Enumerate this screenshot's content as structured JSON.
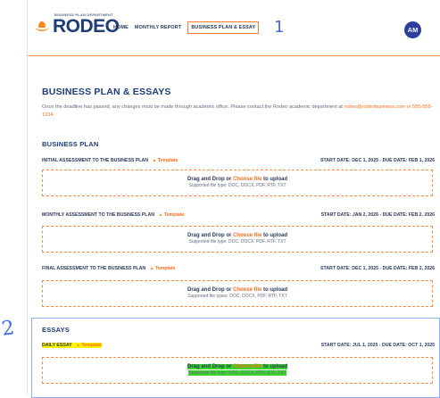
{
  "header": {
    "logo_tagline": "BUSINESS PLAN DEPARTMENT",
    "logo_word": "RODEO",
    "nav": [
      "HOME",
      "MONTHLY REPORT",
      "BUSINESS PLAN & ESSAY"
    ],
    "active_index": 2,
    "annotation_1": "1",
    "avatar_initials": "AM"
  },
  "main": {
    "title": "BUSINESS PLAN & ESSAYS",
    "notice_text": "Once the deadline has passed, any changes must be made through academic office. Please contact the Rodeo academic department at",
    "notice_contact": "rodeo@rodeobusiness.com or 555-555-1234."
  },
  "business_plan": {
    "section_title": "BUSINESS PLAN",
    "items": [
      {
        "label": "INITIAL ASSESSMENT TO THE BUSINESS PLAN",
        "template": "Template",
        "dates": "START DATE: DEC 1, 2025 - DUE DATE: FEB 1, 2026",
        "dz_prefix": "Drag and Drop or",
        "dz_choose": "Choose file",
        "dz_suffix": "to upload",
        "dz_formats": "Supported file type: DOC, DOCX, PDF, RTF, TXT"
      },
      {
        "label": "MONTHLY ASSESSMENT TO THE BUSINESS PLAN",
        "template": "Template",
        "dates": "START DATE: JAN 2, 2026 - DUE DATE: FEB 2, 2026",
        "dz_prefix": "Drag and Drop or",
        "dz_choose": "Choose file",
        "dz_suffix": "to upload",
        "dz_formats": "Supported file type: DOC, DOCX, PDF, RTF, TXT"
      },
      {
        "label": "FINAL ASSESSMENT TO THE BUSINESS PLAN",
        "template": "Template",
        "dates": "START DATE: DEC 1, 2025 - DUE DATE: FEB 2, 2026",
        "dz_prefix": "Drag and Drop or",
        "dz_choose": "Choose file",
        "dz_suffix": "to upload",
        "dz_formats": "Supported file types: DOC, DOCX, PDF, RTF, TXT"
      }
    ]
  },
  "essays": {
    "section_title": "ESSAYS",
    "annotation_2": "2",
    "items": [
      {
        "label": "DAILY ESSAY",
        "template": "Template",
        "dates": "START DATE: JUL 1, 2025 - DUE DATE: OCT 1, 2025",
        "dz_prefix": "Drag and Drop or",
        "dz_choose": "Choose file",
        "dz_suffix": "to upload",
        "dz_formats": "Supported file type: DOC, DOCX, PDF, RTF, TXT"
      }
    ]
  },
  "colors": {
    "accent": "#ff6b1a",
    "navy": "#1d3c78",
    "highlight_yellow": "#fff200",
    "highlight_green": "#39d52a",
    "annotation_blue": "#3f6ed6"
  },
  "icons": [
    "hat-logo-icon",
    "warning-icon"
  ]
}
